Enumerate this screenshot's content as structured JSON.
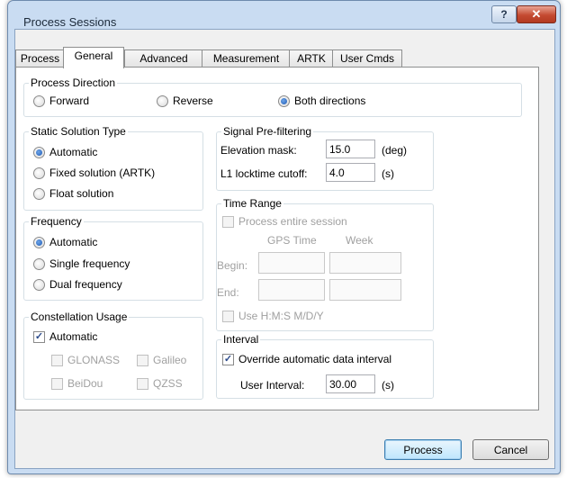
{
  "window": {
    "title": "Process Sessions",
    "help_label": "?",
    "close_label": "✕"
  },
  "tabs": [
    "Process",
    "General",
    "Advanced",
    "Measurement",
    "ARTK",
    "User Cmds"
  ],
  "active_tab": "General",
  "process_direction": {
    "title": "Process Direction",
    "options": [
      "Forward",
      "Reverse",
      "Both directions"
    ],
    "selected": "Both directions"
  },
  "static_solution": {
    "title": "Static Solution Type",
    "options": [
      "Automatic",
      "Fixed solution (ARTK)",
      "Float solution"
    ],
    "selected": "Automatic"
  },
  "frequency": {
    "title": "Frequency",
    "options": [
      "Automatic",
      "Single frequency",
      "Dual frequency"
    ],
    "selected": "Automatic"
  },
  "constellation": {
    "title": "Constellation Usage",
    "automatic_label": "Automatic",
    "automatic_checked": true,
    "glonass": "GLONASS",
    "galileo": "Galileo",
    "beidou": "BeiDou",
    "qzss": "QZSS"
  },
  "prefilter": {
    "title": "Signal Pre-filtering",
    "elevation_label": "Elevation mask:",
    "elevation_value": "15.0",
    "elevation_unit": "(deg)",
    "locktime_label": "L1 locktime cutoff:",
    "locktime_value": "4.0",
    "locktime_unit": "(s)"
  },
  "time_range": {
    "title": "Time Range",
    "entire_session_label": "Process entire session",
    "gps_time_header": "GPS Time",
    "week_header": "Week",
    "begin_label": "Begin:",
    "end_label": "End:",
    "hms_label": "Use H:M:S M/D/Y"
  },
  "interval": {
    "title": "Interval",
    "override_label": "Override automatic data interval",
    "override_checked": true,
    "user_interval_label": "User Interval:",
    "user_interval_value": "30.00",
    "user_interval_unit": "(s)"
  },
  "buttons": {
    "process": "Process",
    "cancel": "Cancel"
  }
}
